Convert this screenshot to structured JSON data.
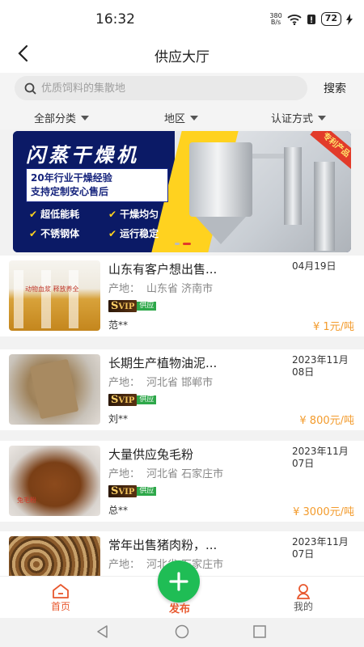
{
  "status": {
    "time": "16:32",
    "net_speed_top": "380",
    "net_speed_bottom": "B/s",
    "battery": "72"
  },
  "nav": {
    "title": "供应大厅"
  },
  "search": {
    "placeholder": "优质饲料的集散地",
    "button": "搜索"
  },
  "filters": [
    {
      "label": "全部分类"
    },
    {
      "label": "地区"
    },
    {
      "label": "认证方式"
    }
  ],
  "banner": {
    "headline": "闪蒸干燥机",
    "sub_line1": "20年行业干燥经验",
    "sub_line2": "支持定制安心售后",
    "features": [
      "超低能耗",
      "干燥均匀",
      "不锈钢体",
      "运行稳定"
    ],
    "ribbon": "专利产品"
  },
  "listings": [
    {
      "title": "山东有客户想出售...",
      "date": "04月19日",
      "origin_label": "产地：",
      "origin": "山东省 济南市",
      "badge_vip": "VIP",
      "badge_s": "S",
      "badge_tag": "供应",
      "seller": "范**",
      "price": "¥ 1元/吨"
    },
    {
      "title": "长期生产植物油泥...",
      "date": "2023年11月08日",
      "origin_label": "产地：",
      "origin": "河北省 邯郸市",
      "badge_vip": "VIP",
      "badge_s": "S",
      "badge_tag": "供应",
      "seller": "刘**",
      "price": "¥ 800元/吨"
    },
    {
      "title": "大量供应兔毛粉",
      "date": "2023年11月07日",
      "origin_label": "产地：",
      "origin": "河北省 石家庄市",
      "badge_vip": "VIP",
      "badge_s": "S",
      "badge_tag": "供应",
      "seller": "总**",
      "price": "¥ 3000元/吨"
    },
    {
      "title": "常年出售猪肉粉，...",
      "date": "2023年11月07日",
      "origin_label": "产地：",
      "origin": "河北省 石家庄市",
      "badge_vip": "",
      "badge_s": "",
      "badge_tag": "",
      "seller": "",
      "price": ""
    }
  ],
  "thumb1_text": "动物血浆 释放养全",
  "thumb3_text": "兔毛粉",
  "tabs": {
    "home": "首页",
    "publish": "发布",
    "mine": "我的"
  },
  "colors": {
    "accent": "#e8582e",
    "price": "#f39b2c",
    "fab": "#1fbd55"
  }
}
